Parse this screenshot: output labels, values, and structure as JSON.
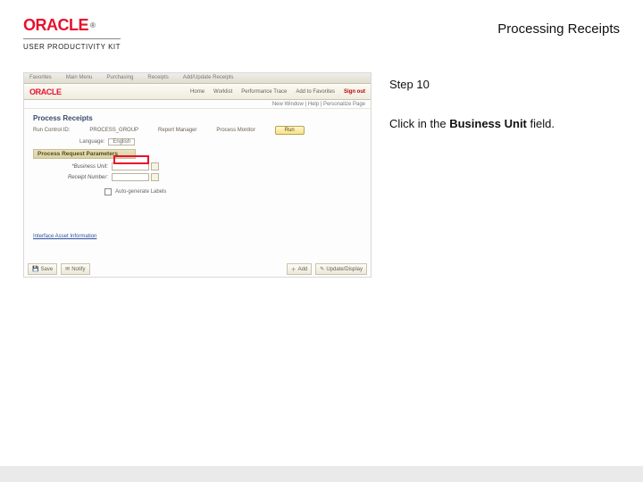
{
  "header": {
    "brand": "ORACLE",
    "brand_tm": "®",
    "upk_label": "USER PRODUCTIVITY KIT",
    "page_title": "Processing Receipts"
  },
  "instructions": {
    "step_label": "Step 10",
    "text_before": "Click in the ",
    "text_bold": "Business Unit",
    "text_after": " field."
  },
  "screenshot": {
    "menubar": {
      "i1": "Favorites",
      "i2": "Main Menu",
      "i3": "Purchasing",
      "i4": "Receipts",
      "i5": "Add/Update Receipts"
    },
    "topbar": {
      "brand": "ORACLE",
      "links": {
        "home": "Home",
        "worklist": "Worklist",
        "perf": "Performance Trace",
        "addfav": "Add to Favorites",
        "signout": "Sign out"
      }
    },
    "searchline": "New Window | Help | Personalize Page",
    "page_heading": "Process Receipts",
    "midrow": {
      "run_ctl": "Run Control ID:",
      "run_ctl_val": "PROCESS_GROUP",
      "rpt_mgr": "Report Manager",
      "proc_mon": "Process Monitor",
      "run_btn": "Run"
    },
    "lang": {
      "label": "Language:",
      "value": "English"
    },
    "section_params": "Process Request Parameters",
    "form": {
      "bu_label": "*Business Unit:",
      "recv_label": "Receipt Number:",
      "auto_label": "Auto-generate Labels"
    },
    "info_link": "Interface Asset Information",
    "footer": {
      "save": "Save",
      "notify": "Notify",
      "add": "Add",
      "update": "Update/Display"
    }
  }
}
